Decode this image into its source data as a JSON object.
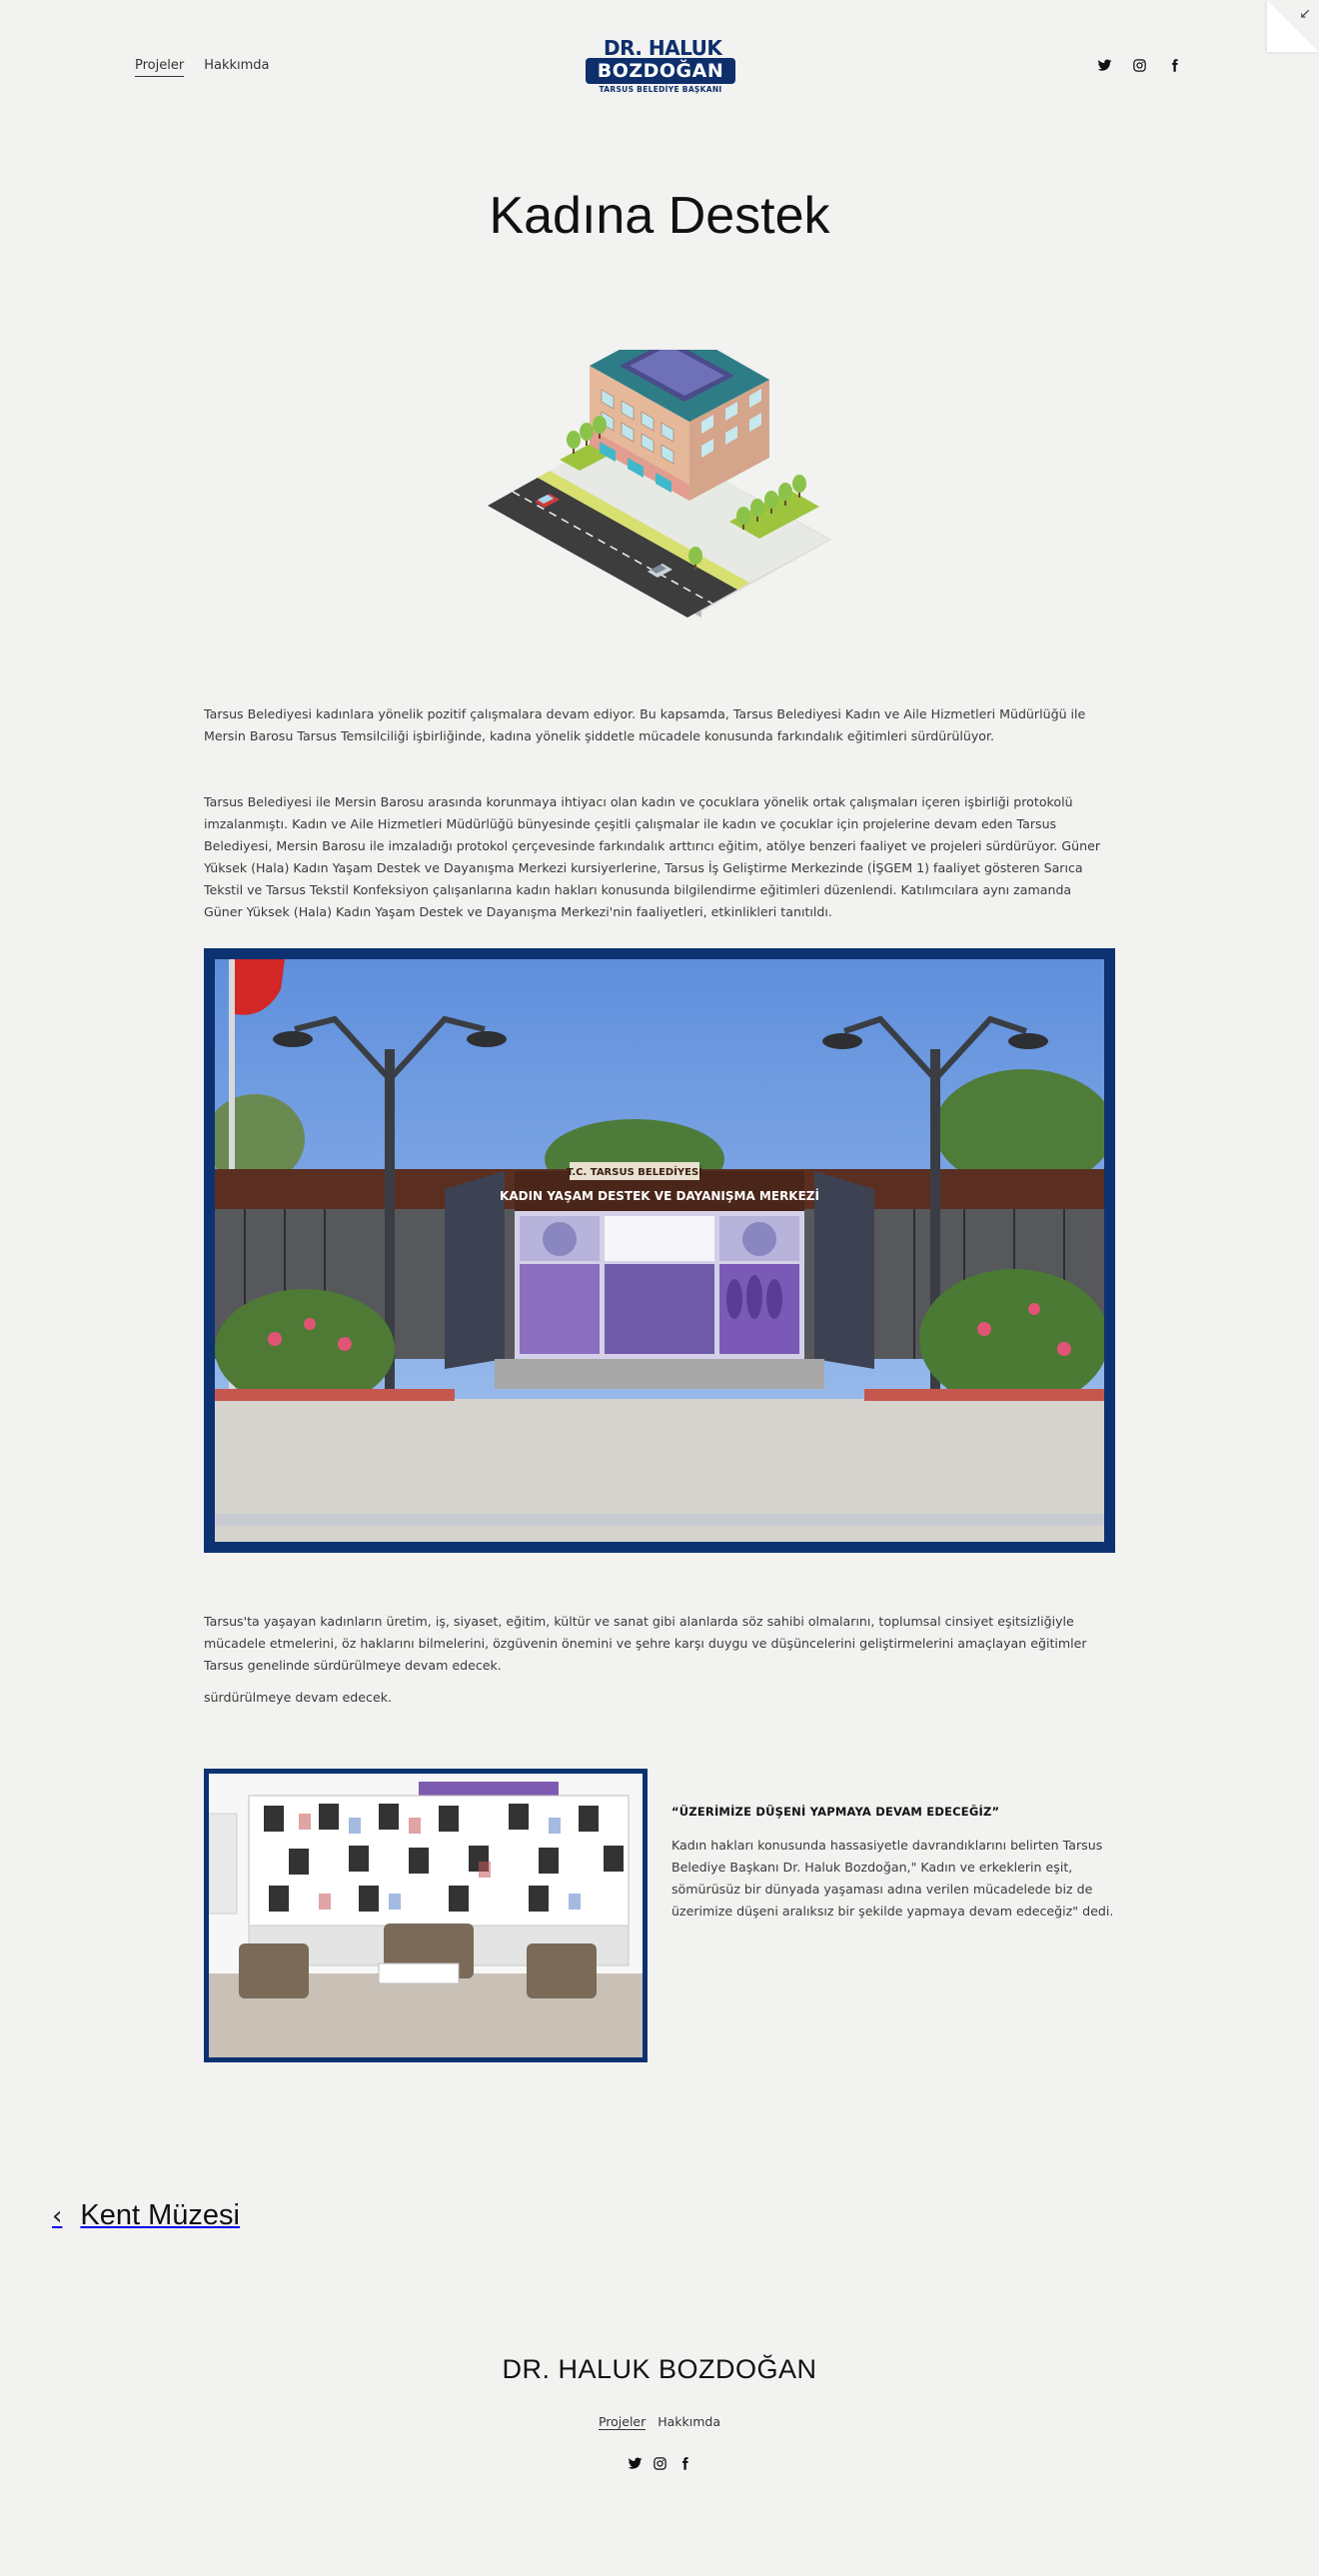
{
  "header": {
    "nav": [
      {
        "label": "Projeler"
      },
      {
        "label": "Hakkımda"
      }
    ],
    "logo": {
      "line1": "DR. HALUK",
      "line2": "BOZDOĞAN",
      "line3": "TARSUS BELEDİYE BAŞKANI"
    },
    "social": [
      "twitter-icon",
      "instagram-icon",
      "facebook-icon"
    ]
  },
  "page": {
    "title": "Kadına Destek"
  },
  "content": {
    "paragraph1": "Tarsus Belediyesi kadınlara yönelik pozitif çalışmalara devam ediyor.  Bu kapsamda, Tarsus Belediyesi Kadın ve Aile Hizmetleri Müdürlüğü ile Mersin Barosu Tarsus Temsilciliği işbirliğinde, kadına yönelik şiddetle mücadele konusunda farkındalık eğitimleri sürdürülüyor.",
    "paragraph2": "Tarsus Belediyesi ile Mersin Barosu arasında korunmaya ihtiyacı olan kadın ve çocuklara yönelik ortak çalışmaları içeren işbirliği protokolü imzalanmıştı. Kadın ve Aile Hizmetleri Müdürlüğü bünyesinde çeşitli çalışmalar ile kadın ve çocuklar için projelerine devam eden Tarsus Belediyesi, Mersin Barosu ile imzaladığı protokol çerçevesinde farkındalık arttırıcı eğitim, atölye benzeri faaliyet ve projeleri sürdürüyor. Güner Yüksek (Hala) Kadın Yaşam Destek ve Dayanışma Merkezi kursiyerlerine, Tarsus İş Geliştirme Merkezinde (İŞGEM 1) faaliyet gösteren Sarıca Tekstil ve Tarsus Tekstil Konfeksiyon çalışanlarına kadın hakları konusunda bilgilendirme eğitimleri düzenlendi. Katılımcılara aynı zamanda Güner Yüksek (Hala) Kadın Yaşam Destek ve Dayanışma Merkezi'nin faaliyetleri, etkinlikleri tanıtıldı.",
    "paragraph3": "Tarsus'ta yaşayan kadınların üretim, iş, siyaset, eğitim, kültür ve sanat gibi alanlarda söz sahibi olmalarını, toplumsal cinsiyet eşitsizliğiyle mücadele etmelerini, öz haklarını bilmelerini, özgüvenin önemini ve şehre karşı duygu ve düşüncelerini geliştirmelerini amaçlayan eğitimler Tarsus genelinde sürdürülmeye devam edecek.",
    "paragraph4": "sürdürülmeye devam edecek.",
    "quote_title": "“ÜZERİMİZE DÜŞENİ YAPMAYA DEVAM EDECEĞİZ”",
    "quote_body": "Kadın hakları konusunda hassasiyetle davrandıklarını belirten Tarsus Belediye Başkanı Dr. Haluk Bozdoğan,\" Kadın ve erkeklerin eşit, sömürüsüz bir dünyada yaşaması adına verilen mücadelede biz de üzerimize düşeni aralıksız bir şekilde yapmaya devam edeceğiz\" dedi.",
    "building_sign_top": "T.C. TARSUS BELEDİYESİ",
    "building_sign_main": "KADIN YAŞAM DESTEK VE DAYANIŞMA MERKEZİ"
  },
  "prev_project": {
    "label": "Kent Müzesi"
  },
  "footer": {
    "title": "DR. HALUK BOZDOĞAN",
    "nav": [
      {
        "label": "Projeler"
      },
      {
        "label": "Hakkımda"
      }
    ]
  },
  "colors": {
    "background": "#f2f2f0",
    "brand_navy": "#0e2f6b",
    "photo_frame": "#0d3271"
  }
}
